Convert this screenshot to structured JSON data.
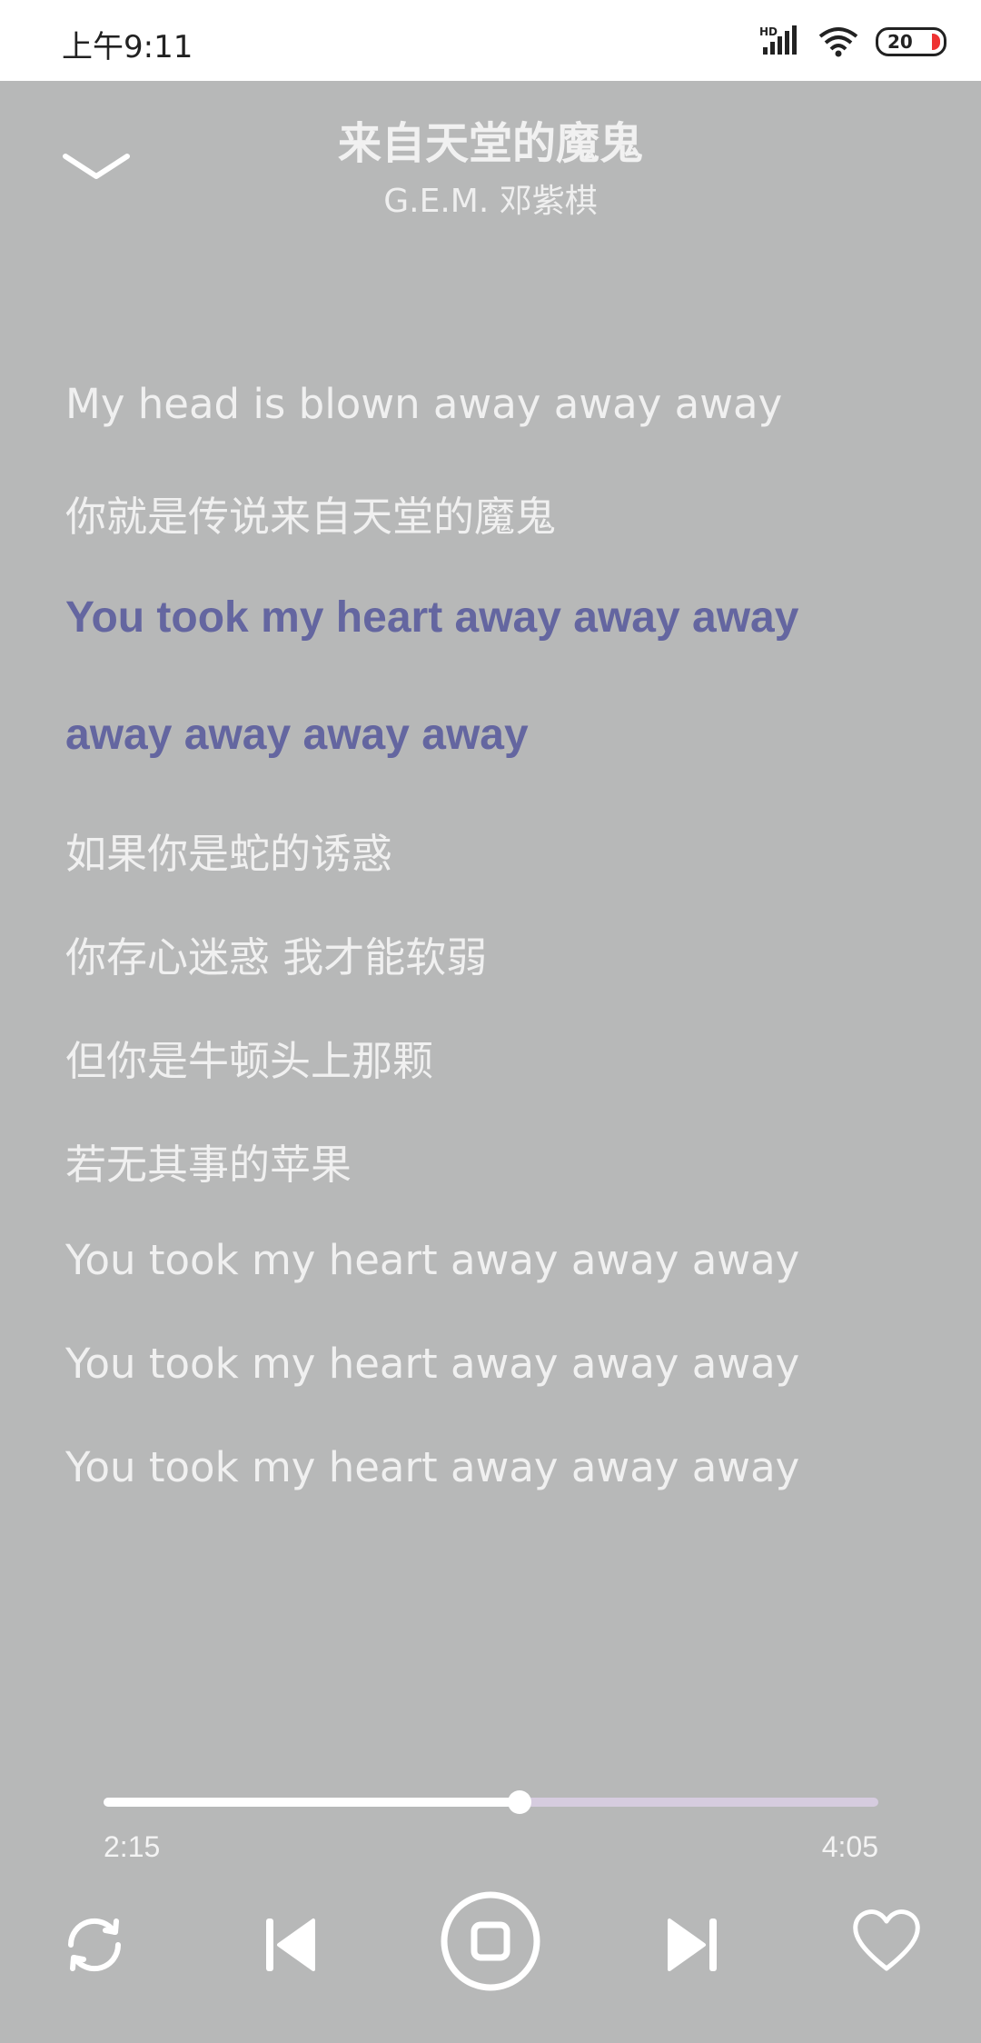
{
  "status_bar": {
    "time": "上午9:11",
    "network_label": "HD",
    "battery_level": "20"
  },
  "header": {
    "song_title": "来自天堂的魔鬼",
    "artist": "G.E.M. 邓紫棋"
  },
  "lyrics": [
    "My head is blown away away away",
    "你就是传说来自天堂的魔鬼",
    "You took my heart away away away",
    "away away away away",
    "如果你是蛇的诱惑",
    "你存心迷惑 我才能软弱",
    "但你是牛顿头上那颗",
    "若无其事的苹果",
    "You took my heart away away away",
    "You took my heart away away away",
    "You took my heart away away away"
  ],
  "active_lyric_indices": [
    2,
    3
  ],
  "player": {
    "elapsed": "2:15",
    "total": "4:05",
    "progress_fraction": 0.537
  },
  "colors": {
    "background": "#b7b8b8",
    "active_lyric": "#6466a0",
    "track_unfilled": "#d6ccdf"
  },
  "icons": {
    "collapse": "chevron-down-icon",
    "repeat": "repeat-icon",
    "previous": "skip-previous-icon",
    "pause": "pause-icon",
    "next": "skip-next-icon",
    "favorite": "heart-icon"
  }
}
